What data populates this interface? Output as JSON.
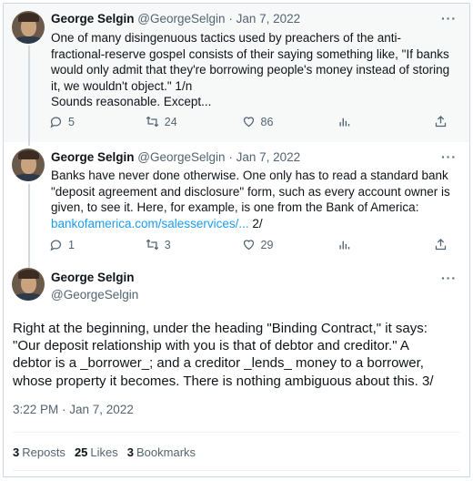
{
  "tweets": [
    {
      "name": "George Selgin",
      "handle": "@GeorgeSelgin",
      "date": "Jan 7, 2022",
      "lines": [
        "One of many disingenuous tactics used by preachers of the anti-",
        "fractional-reserve gospel consists of their saying something like, \"If banks",
        "would only admit that they're  borrowing people's money instead of storing",
        "it, we wouldn't object.\" 1/n",
        "Sounds reasonable. Except..."
      ],
      "replies": "5",
      "retweets": "24",
      "likes": "86"
    },
    {
      "name": "George Selgin",
      "handle": "@GeorgeSelgin",
      "date": "Jan 7, 2022",
      "lines": [
        "Banks have never done otherwise. One only has to read a standard bank",
        "\"deposit agreement and disclosure\" form, such as every account owner is",
        "given, to see it. Here, for example, is one from the Bank of America:"
      ],
      "link": "bankofamerica.com/salesservices/...",
      "link_suffix": " 2/",
      "replies": "1",
      "retweets": "3",
      "likes": "29"
    }
  ],
  "main_tweet": {
    "name": "George Selgin",
    "handle": "@GeorgeSelgin",
    "lines": [
      "Right at the beginning, under the heading \"Binding Contract,\" it says:",
      "\"Our deposit relationship with you is that of debtor and creditor.\" A",
      "debtor is a _borrower_; and a creditor _lends_ money to a borrower,",
      "whose property it becomes. There is nothing ambiguous about this. 3/"
    ],
    "timestamp": "3:22 PM · Jan 7, 2022",
    "reposts_count": "3",
    "reposts_label": "Reposts",
    "likes_count": "25",
    "likes_label": "Likes",
    "bookmarks_count": "3",
    "bookmarks_label": "Bookmarks"
  },
  "more_glyph": "···",
  "separator": " · "
}
